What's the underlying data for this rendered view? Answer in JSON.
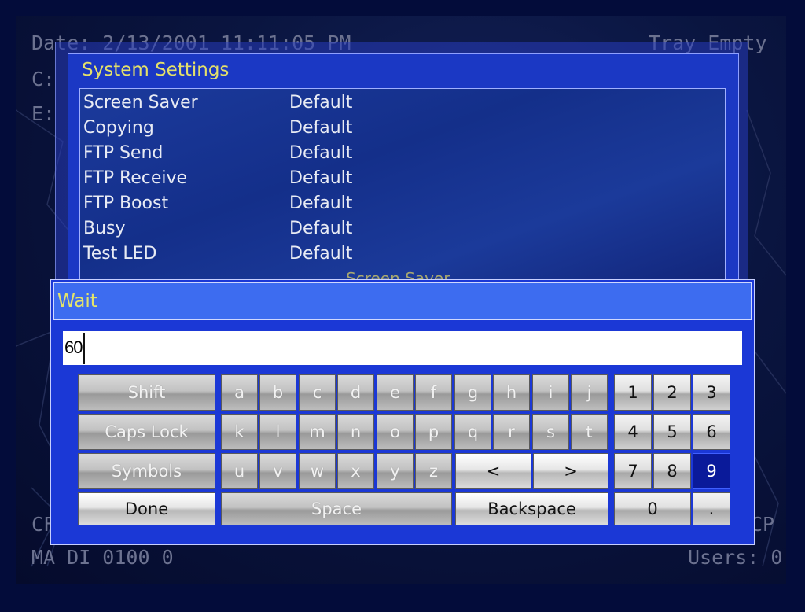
{
  "background": {
    "date_line": "Date: 2/13/2001 11:11:05 PM",
    "tray_line": "Tray Empty",
    "drive_c": "C:",
    "drive_e": "E:",
    "bottom_left_1": "CF",
    "bottom_left_2": "MA DI 0100 0",
    "bottom_right_1": "CP",
    "bottom_right_2": "Users: 0"
  },
  "settings": {
    "title": "System Settings",
    "rows": [
      {
        "name": "Screen Saver",
        "value": "Default"
      },
      {
        "name": "Copying",
        "value": "Default"
      },
      {
        "name": "FTP Send",
        "value": "Default"
      },
      {
        "name": "FTP Receive",
        "value": "Default"
      },
      {
        "name": "FTP Boost",
        "value": "Default"
      },
      {
        "name": "Busy",
        "value": "Default"
      },
      {
        "name": "Test LED",
        "value": "Default"
      }
    ],
    "subheading": "Screen Saver"
  },
  "keyboard": {
    "title": "Wait",
    "entry_value": "60",
    "keys": {
      "shift": "Shift",
      "caps_lock": "Caps Lock",
      "symbols": "Symbols",
      "done": "Done",
      "space": "Space",
      "backspace": "Backspace",
      "left": "<",
      "right": ">",
      "row1": [
        "a",
        "b",
        "c",
        "d",
        "e",
        "f",
        "g",
        "h",
        "i",
        "j"
      ],
      "row2": [
        "k",
        "l",
        "m",
        "n",
        "o",
        "p",
        "q",
        "r",
        "s",
        "t"
      ],
      "row3": [
        "u",
        "v",
        "w",
        "x",
        "y",
        "z"
      ],
      "num1": [
        "1",
        "2",
        "3"
      ],
      "num2": [
        "4",
        "5",
        "6"
      ],
      "num3": [
        "7",
        "8",
        "9"
      ],
      "zero": "0",
      "dot": "."
    },
    "selected_key": "9"
  },
  "colors": {
    "title_text": "#e4e46a",
    "dialog_blue": "#1b38d6",
    "selected_key": "#0a1a9a"
  }
}
